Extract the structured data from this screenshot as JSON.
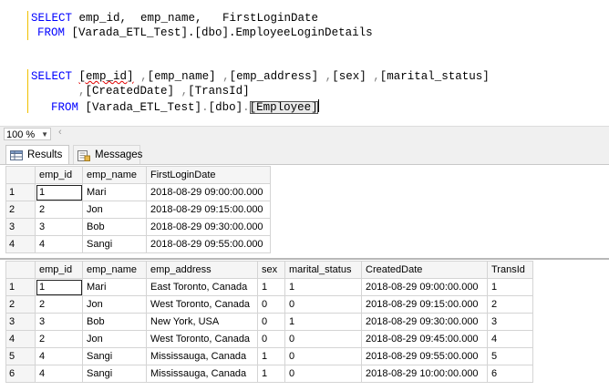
{
  "editor": {
    "query1": {
      "select_kw": "SELECT",
      "cols": " emp_id,  emp_name,   FirstLoginDate",
      "from_kw": "FROM",
      "table": " [Varada_ETL_Test].[dbo].EmployeeLoginDetails"
    },
    "query2": {
      "select_kw": "SELECT",
      "col1": "[emp_id]",
      "col2": "[emp_name]",
      "col3": "[emp_address]",
      "col4": "[sex]",
      "col5": "[marital_status]",
      "col6": "[CreatedDate]",
      "col7": "[TransId]",
      "from_kw": "FROM",
      "db": "[Varada_ETL_Test]",
      "schema": "[dbo]",
      "table": "[Employee]"
    }
  },
  "zoom": {
    "value": "100 %"
  },
  "tabs": {
    "results": "Results",
    "messages": "Messages"
  },
  "grid1": {
    "headers": [
      "emp_id",
      "emp_name",
      "FirstLoginDate"
    ],
    "rows": [
      {
        "n": "1",
        "cells": [
          "1",
          "Mari",
          "2018-08-29 09:00:00.000"
        ]
      },
      {
        "n": "2",
        "cells": [
          "2",
          "Jon",
          "2018-08-29 09:15:00.000"
        ]
      },
      {
        "n": "3",
        "cells": [
          "3",
          "Bob",
          "2018-08-29 09:30:00.000"
        ]
      },
      {
        "n": "4",
        "cells": [
          "4",
          "Sangi",
          "2018-08-29 09:55:00.000"
        ]
      }
    ]
  },
  "grid2": {
    "headers": [
      "emp_id",
      "emp_name",
      "emp_address",
      "sex",
      "marital_status",
      "CreatedDate",
      "TransId"
    ],
    "rows": [
      {
        "n": "1",
        "cells": [
          "1",
          "Mari",
          "East Toronto, Canada",
          "1",
          "1",
          "2018-08-29 09:00:00.000",
          "1"
        ]
      },
      {
        "n": "2",
        "cells": [
          "2",
          "Jon",
          "West Toronto, Canada",
          "0",
          "0",
          "2018-08-29 09:15:00.000",
          "2"
        ]
      },
      {
        "n": "3",
        "cells": [
          "3",
          "Bob",
          "New York, USA",
          "0",
          "1",
          "2018-08-29 09:30:00.000",
          "3"
        ]
      },
      {
        "n": "4",
        "cells": [
          "2",
          "Jon",
          "West Toronto, Canada",
          "0",
          "0",
          "2018-08-29 09:45:00.000",
          "4"
        ]
      },
      {
        "n": "5",
        "cells": [
          "4",
          "Sangi",
          "Mississauga, Canada",
          "1",
          "0",
          "2018-08-29 09:55:00.000",
          "5"
        ]
      },
      {
        "n": "6",
        "cells": [
          "4",
          "Sangi",
          "Mississauga, Canada",
          "1",
          "0",
          "2018-08-29 10:00:00.000",
          "6"
        ]
      }
    ]
  }
}
